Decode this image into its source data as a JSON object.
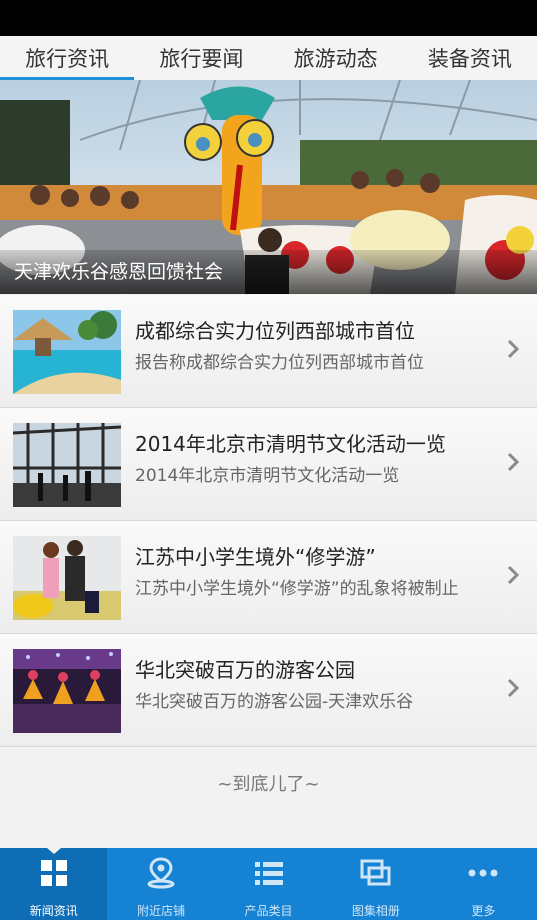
{
  "tabs": [
    {
      "label": "旅行资讯",
      "active": true
    },
    {
      "label": "旅行要闻",
      "active": false
    },
    {
      "label": "旅游动态",
      "active": false
    },
    {
      "label": "装备资讯",
      "active": false
    }
  ],
  "hero": {
    "caption": "天津欢乐谷感恩回馈社会"
  },
  "articles": [
    {
      "title": "成都综合实力位列西部城市首位",
      "desc": "报告称成都综合实力位列西部城市首位"
    },
    {
      "title": "2014年北京市清明节文化活动一览",
      "desc": "2014年北京市清明节文化活动一览"
    },
    {
      "title": "江苏中小学生境外“修学游”",
      "desc": "江苏中小学生境外“修学游”的乱象将被制止"
    },
    {
      "title": "华北突破百万的游客公园",
      "desc": "华北突破百万的游客公园-天津欢乐谷"
    }
  ],
  "end_text": "~到底儿了~",
  "bottom_nav": [
    {
      "label": "新闻资讯",
      "icon": "grid-icon",
      "active": true
    },
    {
      "label": "附近店铺",
      "icon": "location-pin-icon",
      "active": false
    },
    {
      "label": "产品类目",
      "icon": "list-icon",
      "active": false
    },
    {
      "label": "图集相册",
      "icon": "gallery-icon",
      "active": false
    },
    {
      "label": "更多",
      "icon": "more-dots-icon",
      "active": false
    }
  ],
  "colors": {
    "accent": "#1e90d6",
    "nav_bg": "#1582d4",
    "nav_active_bg": "#0f6db5",
    "status_bar": "#000000"
  }
}
